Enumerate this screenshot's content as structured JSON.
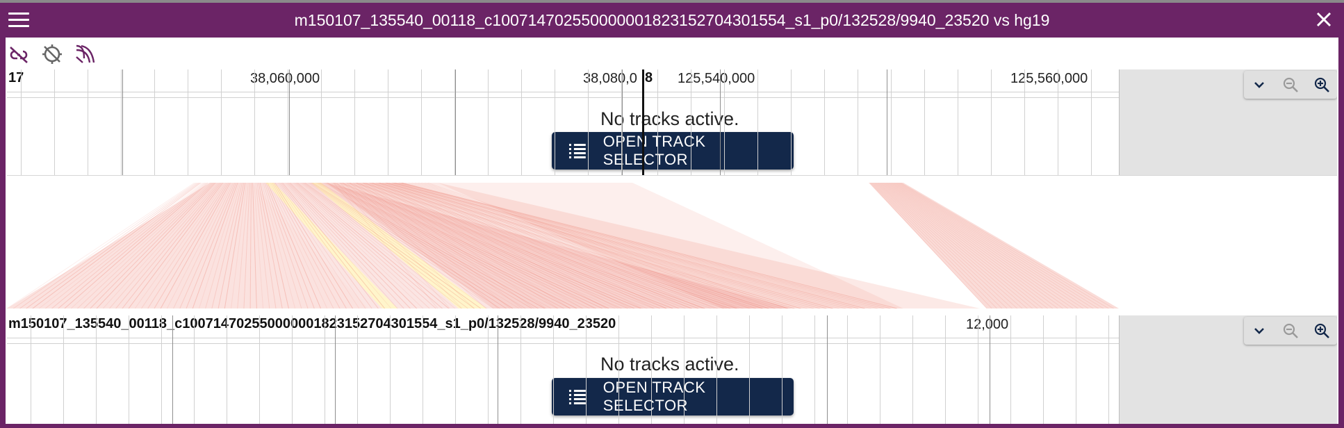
{
  "window": {
    "title": "m150107_135540_00118_c100714702550000001823152704301554_s1_p0/132528/9940_23520 vs hg19",
    "menu_icon": "hamburger-menu-icon",
    "close_icon": "close-icon",
    "accent_color": "#6b2466"
  },
  "toolbar": {
    "icons": [
      "link-off-icon",
      "crosshair-off-icon",
      "curve-lines-icon"
    ]
  },
  "top_view": {
    "ref_labels": [
      "17",
      "8"
    ],
    "tick_labels": [
      "38,060,000",
      "38,080,0",
      "125,540,000",
      "125,560,000"
    ],
    "no_tracks_text": "No tracks active.",
    "button_label": "OPEN TRACK SELECTOR",
    "zoom_icons": [
      "chevron-down-icon",
      "zoom-out-icon",
      "zoom-in-icon"
    ]
  },
  "bottom_view": {
    "ref_label": "m150107_135540_00118_c100714702550000001823152704301554_s1_p0/132528/9940_23520",
    "tick_labels": [
      "12,000"
    ],
    "no_tracks_text": "No tracks active.",
    "button_label": "OPEN TRACK SELECTOR",
    "zoom_icons": [
      "chevron-down-icon",
      "zoom-out-icon",
      "zoom-in-icon"
    ]
  },
  "colors": {
    "synteny_red": "#e8604f",
    "synteny_yellow": "#fff6c8",
    "button_bg": "#13284a"
  }
}
